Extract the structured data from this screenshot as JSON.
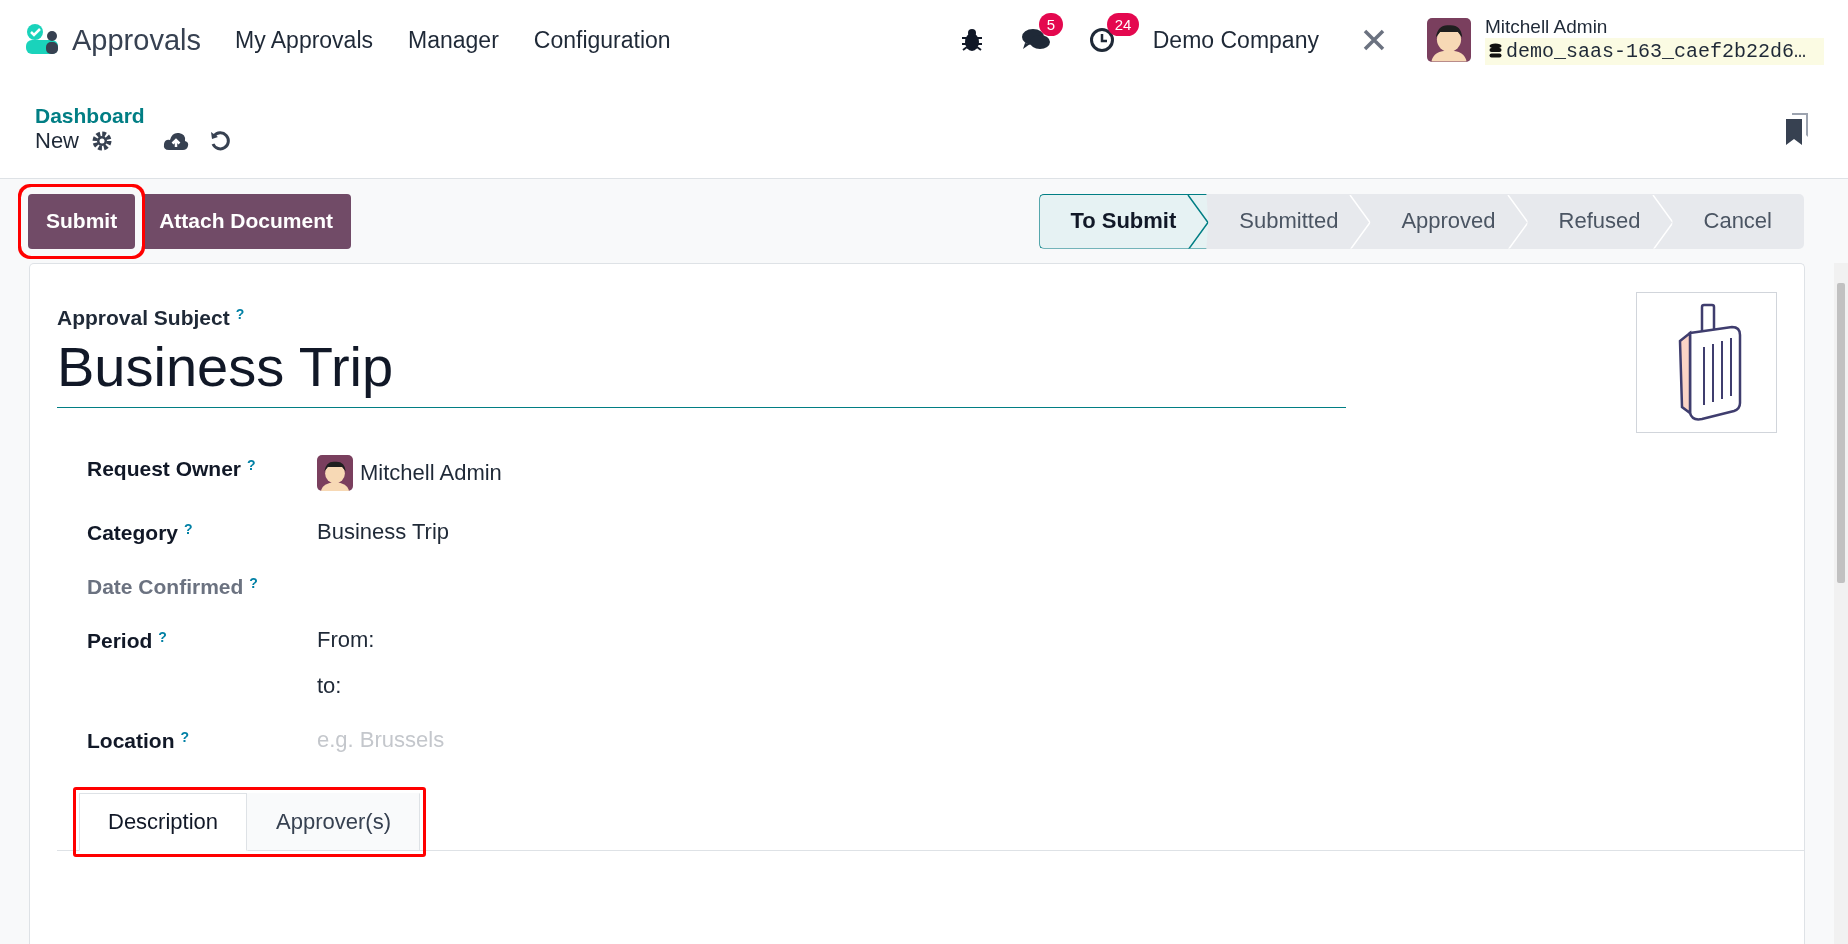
{
  "navbar": {
    "app_name": "Approvals",
    "menu": [
      "My Approvals",
      "Manager",
      "Configuration"
    ],
    "messages_count": "5",
    "activities_count": "24",
    "company": "Demo Company",
    "user": {
      "name": "Mitchell Admin",
      "database": "demo_saas-163_caef2b22d6…"
    }
  },
  "breadcrumb": {
    "parent": "Dashboard",
    "current": "New"
  },
  "actions": [
    {
      "label": "Submit",
      "highlighted": true
    },
    {
      "label": "Attach Document",
      "highlighted": false
    }
  ],
  "stages": [
    {
      "label": "To Submit",
      "selected": true
    },
    {
      "label": "Submitted",
      "selected": false
    },
    {
      "label": "Approved",
      "selected": false
    },
    {
      "label": "Refused",
      "selected": false
    },
    {
      "label": "Cancel",
      "selected": false
    }
  ],
  "form": {
    "subject_label": "Approval Subject",
    "help_mark": "?",
    "subject": "Business Trip",
    "fields": [
      {
        "label": "Request Owner",
        "help": "?",
        "kind": "user",
        "value": "Mitchell Admin",
        "muted": false
      },
      {
        "label": "Category",
        "help": "?",
        "kind": "text",
        "value": "Business Trip",
        "muted": false
      },
      {
        "label": "Date Confirmed",
        "help": "?",
        "kind": "empty",
        "muted": true
      },
      {
        "label": "Period",
        "help": "?",
        "kind": "range",
        "from_label": "From:",
        "to_label": "to:",
        "muted": false
      },
      {
        "label": "Location",
        "help": "?",
        "kind": "input",
        "placeholder": "e.g. Brussels",
        "muted": false
      }
    ]
  },
  "tabs_highlighted": true,
  "tabs": [
    {
      "label": "Description",
      "selected": true
    },
    {
      "label": "Approver(s)",
      "selected": false
    }
  ]
}
